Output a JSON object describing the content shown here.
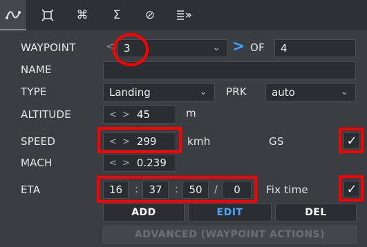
{
  "tabs": [
    {
      "name": "route-icon",
      "glyph": "⌒"
    },
    {
      "name": "target-icon",
      "glyph": "⌘"
    },
    {
      "name": "command-icon",
      "glyph": "⌘"
    },
    {
      "name": "sigma-icon",
      "glyph": "Σ"
    },
    {
      "name": "no-entry-icon",
      "glyph": "⊘"
    },
    {
      "name": "list-arrow-icon",
      "glyph": "≣"
    }
  ],
  "waypoint": {
    "label": "WAYPOINT",
    "value": "3",
    "of_label": "OF",
    "total": "4"
  },
  "name": {
    "label": "NAME",
    "value": ""
  },
  "type": {
    "label": "TYPE",
    "value": "Landing",
    "prk_label": "PRK",
    "prk_value": "auto"
  },
  "altitude": {
    "label": "ALTITUDE",
    "value": "45",
    "unit": "m"
  },
  "speed": {
    "label": "SPEED",
    "value": "299",
    "unit": "kmh",
    "gs_label": "GS",
    "gs_checked": true
  },
  "mach": {
    "label": "MACH",
    "value": "0.239"
  },
  "eta": {
    "label": "ETA",
    "hh": "16",
    "mm": "37",
    "ss": "50",
    "sub": "0",
    "sep_colon": ":",
    "sep_slash": "/",
    "fix_label": "Fix time",
    "fix_checked": true
  },
  "buttons": {
    "add": "ADD",
    "edit": "EDIT",
    "del": "DEL",
    "advanced": "ADVANCED (WAYPOINT ACTIONS)"
  },
  "glyphs": {
    "caret": "⌄",
    "arrows": "< >",
    "check": "✓",
    "prev": "<",
    "next": ">"
  },
  "colors": {
    "accent": "#3ea2ff",
    "annotation": "#ff0000"
  }
}
